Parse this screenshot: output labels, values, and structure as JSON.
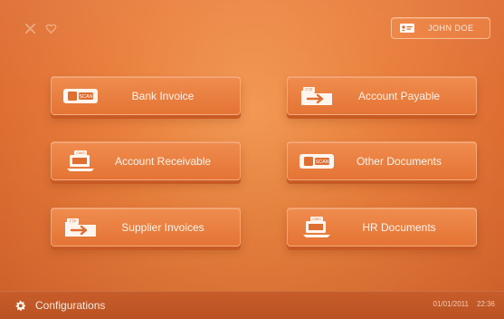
{
  "header": {
    "user_label": "JOHN DOE",
    "left_icons": [
      "close-icon",
      "heart-icon"
    ],
    "user_icon": "user-card-icon"
  },
  "tiles": [
    {
      "label": "Bank Invoice",
      "icon": "bank-invoice-icon",
      "badge": "SCAN"
    },
    {
      "label": "Account Payable",
      "icon": "ftp-folder-icon",
      "badge": "FTP"
    },
    {
      "label": "Account Receivable",
      "icon": "laptop-doc-icon",
      "badge": "CMIS"
    },
    {
      "label": "Other Documents",
      "icon": "other-documents-icon",
      "badge": "SCAN"
    },
    {
      "label": "Supplier Invoices",
      "icon": "ftp-folder-icon",
      "badge": "FTP"
    },
    {
      "label": "HR Documents",
      "icon": "laptop-doc-icon",
      "badge": "CMIS"
    }
  ],
  "footer": {
    "configurations_label": "Configurations",
    "date": "01/01/2011",
    "time": "22:36",
    "config_icon": "gear-icon"
  },
  "colors": {
    "background": "#ea7f3c",
    "tile": "#e47435",
    "tile_shadow": "#c75a25",
    "footer": "#b95223",
    "text": "#fff3ea"
  }
}
